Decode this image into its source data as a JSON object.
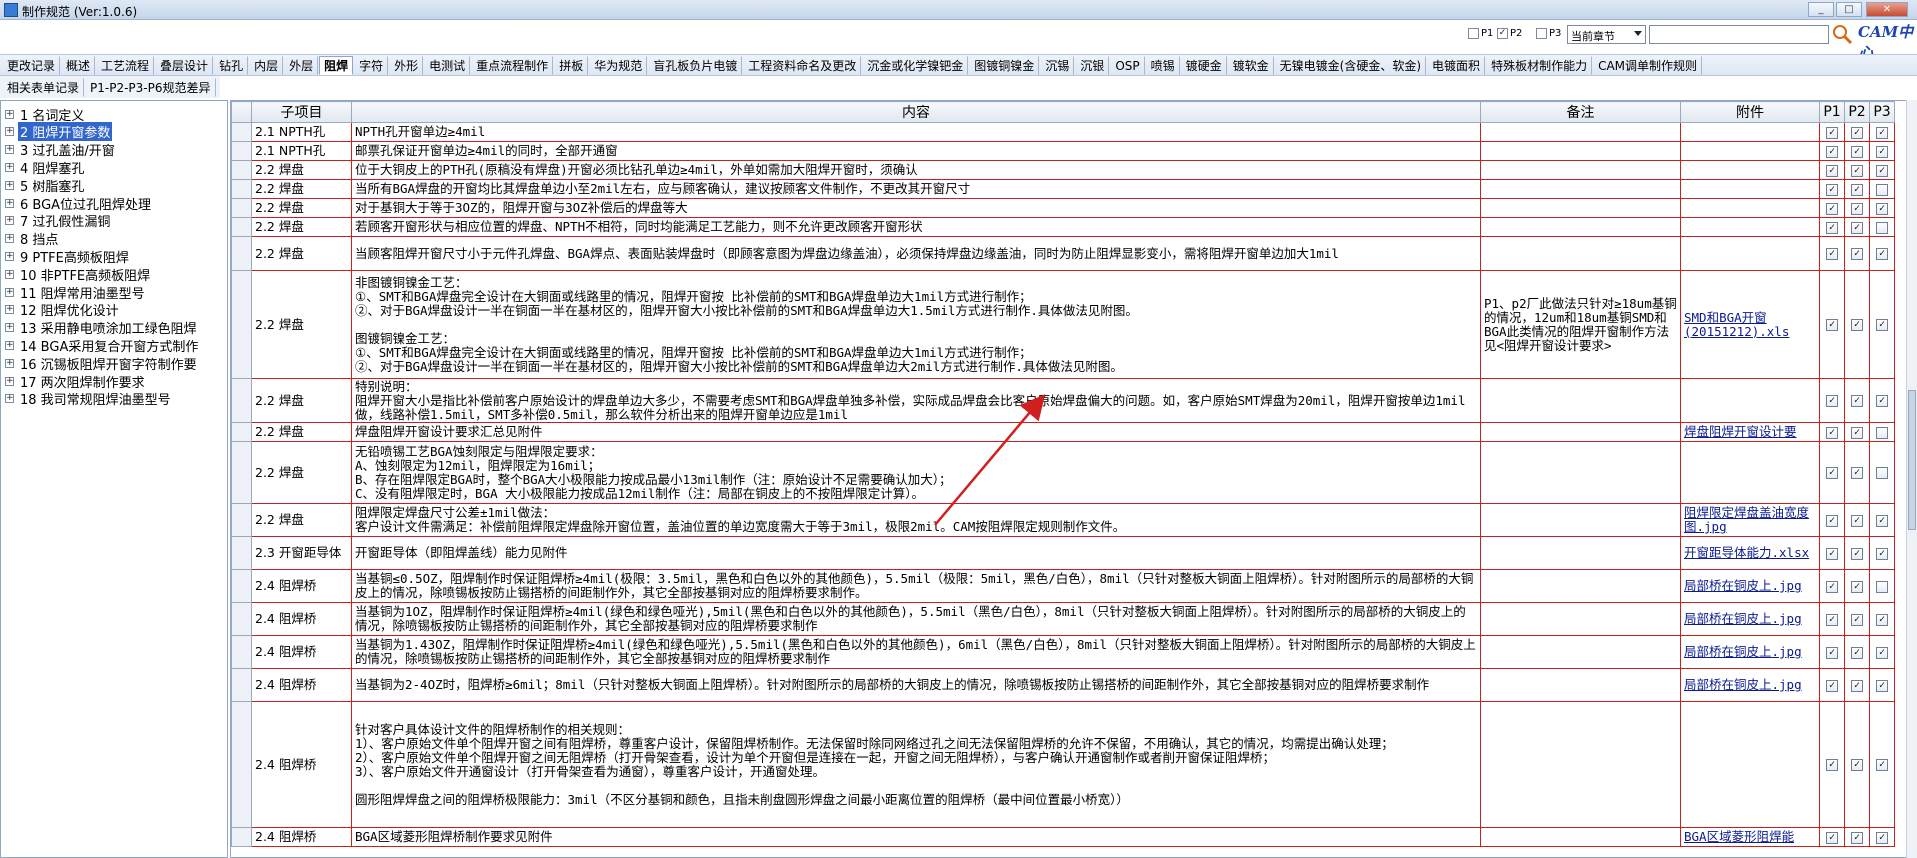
{
  "window": {
    "title": "制作规范 (Ver:1.0.6)"
  },
  "filters": {
    "p1_label": "P1",
    "p1_checked": false,
    "p2_label": "P2",
    "p2_checked": true,
    "p3_label": "P3",
    "p3_checked": false,
    "chapter_select": "当前章节",
    "search_value": "",
    "logo_text": "CAM中心"
  },
  "nav": {
    "row1": [
      "更改记录",
      "概述",
      "工艺流程",
      "叠层设计",
      "钻孔",
      "内层",
      "外层",
      "阻焊",
      "字符",
      "外形",
      "电测试",
      "重点流程制作",
      "拼板",
      "华为规范",
      "盲孔板负片电镀",
      "工程资料命名及更改",
      "沉金或化学镍钯金",
      "图镀铜镍金",
      "沉锡",
      "沉银",
      "OSP",
      "喷锡",
      "镀硬金",
      "镀软金",
      "无镍电镀金(含硬金、软金)",
      "电镀面积",
      "特殊板材制作能力",
      "CAM调单制作规则"
    ],
    "row2": [
      "相关表单记录",
      "P1-P2-P3-P6规范差异"
    ],
    "active": "阻焊"
  },
  "tree": [
    {
      "label": "1  名词定义"
    },
    {
      "label": "2  阻焊开窗参数",
      "selected": true
    },
    {
      "label": "3  过孔盖油/开窗"
    },
    {
      "label": "4  阻焊塞孔"
    },
    {
      "label": "5  树脂塞孔"
    },
    {
      "label": "6  BGA位过孔阻焊处理"
    },
    {
      "label": "7  过孔假性漏铜"
    },
    {
      "label": "8  挡点"
    },
    {
      "label": "9  PTFE高频板阻焊"
    },
    {
      "label": "10  非PTFE高频板阻焊"
    },
    {
      "label": "11  阻焊常用油墨型号"
    },
    {
      "label": "12  阻焊优化设计"
    },
    {
      "label": "13  采用静电喷涂加工绿色阻焊"
    },
    {
      "label": "14  BGA采用复合开窗方式制作"
    },
    {
      "label": "16  沉锡板阻焊开窗字符制作要"
    },
    {
      "label": "17  两次阻焊制作要求"
    },
    {
      "label": "18  我司常规阻焊油墨型号"
    }
  ],
  "grid": {
    "headers": {
      "sub": "子项目",
      "content": "内容",
      "remark": "备注",
      "attach": "附件",
      "p1": "P1",
      "p2": "P2",
      "p3": "P3"
    },
    "rows": [
      {
        "sub": "2.1 NPTH孔",
        "content": "NPTH孔开窗单边≥4mil",
        "remark": "",
        "attach": "",
        "p": [
          true,
          true,
          true
        ]
      },
      {
        "sub": "2.1 NPTH孔",
        "content": "邮票孔保证开窗单边≥4mil的同时，全部开通窗",
        "remark": "",
        "attach": "",
        "p": [
          true,
          true,
          true
        ]
      },
      {
        "sub": "2.2 焊盘",
        "content": "位于大铜皮上的PTH孔(原稿没有焊盘)开窗必须比钻孔单边≥4mil，外单如需加大阻焊开窗时，须确认",
        "remark": "",
        "attach": "",
        "p": [
          true,
          true,
          true
        ]
      },
      {
        "sub": "2.2 焊盘",
        "content": "当所有BGA焊盘的开窗均比其焊盘单边小至2mil左右，应与顾客确认，建议按顾客文件制作，不更改其开窗尺寸",
        "remark": "",
        "attach": "",
        "p": [
          true,
          true,
          false
        ]
      },
      {
        "sub": "2.2 焊盘",
        "content": "对于基铜大于等于3OZ的，阻焊开窗与3OZ补偿后的焊盘等大",
        "remark": "",
        "attach": "",
        "p": [
          true,
          true,
          true
        ]
      },
      {
        "sub": "2.2 焊盘",
        "content": "若顾客开窗形状与相应位置的焊盘、NPTH不相符，同时均能满足工艺能力，则不允许更改顾客开窗形状",
        "remark": "",
        "attach": "",
        "p": [
          true,
          true,
          false
        ]
      },
      {
        "sub": "2.2 焊盘",
        "content": "当顾客阻焊开窗尺寸小于元件孔焊盘、BGA焊点、表面贴装焊盘时（即顾客意图为焊盘边缘盖油），必须保持焊盘边缘盖油，同时为防止阻焊显影变小，需将阻焊开窗单边加大1mil",
        "remark": "",
        "attach": "",
        "p": [
          true,
          true,
          true
        ]
      },
      {
        "sub": "2.2 焊盘",
        "content": "非图镀铜镍金工艺：\n①、SMT和BGA焊盘完全设计在大铜面或线路里的情况，阻焊开窗按 比补偿前的SMT和BGA焊盘单边大1mil方式进行制作；\n②、对于BGA焊盘设计一半在铜面一半在基材区的，阻焊开窗大小按比补偿前的SMT和BGA焊盘单边大1.5mil方式进行制作.具体做法见附图。\n\n图镀铜镍金工艺：\n①、SMT和BGA焊盘完全设计在大铜面或线路里的情况，阻焊开窗按 比补偿前的SMT和BGA焊盘单边大1mil方式进行制作；\n②、对于BGA焊盘设计一半在铜面一半在基材区的，阻焊开窗大小按比补偿前的SMT和BGA焊盘单边大2mil方式进行制作.具体做法见附图。",
        "remark": "P1、p2厂此做法只针对≥18um基铜的情况，12um和18um基铜SMD和BGA此类情况的阻焊开窗制作方法见<阻焊开窗设计要求>",
        "attach": "SMD和BGA开窗 (20151212).xls",
        "p": [
          true,
          true,
          true
        ]
      },
      {
        "sub": "2.2 焊盘",
        "content": "特别说明：\n阻焊开窗大小是指比补偿前客户原始设计的焊盘单边大多少，不需要考虑SMT和BGA焊盘单独多补偿，实际成品焊盘会比客户原始焊盘偏大的问题。如，客户原始SMT焊盘为20mil，阻焊开窗按单边1mil做，线路补偿1.5mil，SMT多补偿0.5mil，那么软件分析出来的阻焊开窗单边应是1mil",
        "remark": "",
        "attach": "",
        "p": [
          true,
          true,
          true
        ]
      },
      {
        "sub": "2.2 焊盘",
        "content": "焊盘阻焊开窗设计要求汇总见附件",
        "remark": "",
        "attach": "焊盘阻焊开窗设计要",
        "p": [
          true,
          true,
          false
        ]
      },
      {
        "sub": "2.2 焊盘",
        "content": "无铅喷锡工艺BGA蚀刻限定与阻焊限定要求：\nA、蚀刻限定为12mil，阻焊限定为16mil；\nB、存在阻焊限定BGA时，整个BGA大小极限能力按成品最小13mil制作（注：原始设计不足需要确认加大）；\nC、没有阻焊限定时，BGA 大小极限能力按成品12mil制作（注：局部在铜皮上的不按阻焊限定计算）。",
        "remark": "",
        "attach": "",
        "p": [
          true,
          true,
          false
        ]
      },
      {
        "sub": "2.2 焊盘",
        "content": "阻焊限定焊盘尺寸公差±1mil做法：\n客户设计文件需满足：补偿前阻焊限定焊盘除开窗位置，盖油位置的单边宽度需大于等于3mil，极限2mil。CAM按阻焊限定规则制作文件。",
        "remark": "",
        "attach": "阻焊限定焊盘盖油宽度图.jpg",
        "p": [
          true,
          true,
          true
        ]
      },
      {
        "sub": "2.3 开窗距导体",
        "content": "开窗距导体（即阻焊盖线）能力见附件",
        "remark": "",
        "attach": "开窗距导体能力.xlsx",
        "p": [
          true,
          true,
          true
        ]
      },
      {
        "sub": "2.4 阻焊桥",
        "content": "当基铜≤0.5OZ，阻焊制作时保证阻焊桥≥4mil(极限：3.5mil，黑色和白色以外的其他颜色)，5.5mil（极限：5mil，黑色/白色），8mil（只针对整板大铜面上阻焊桥）。针对附图所示的局部桥的大铜皮上的情况，除喷锡板按防止锡搭桥的间距制作外，其它全部按基铜对应的阻焊桥要求制作。",
        "remark": "",
        "attach": "局部桥在铜皮上.jpg",
        "p": [
          true,
          true,
          false
        ]
      },
      {
        "sub": "2.4 阻焊桥",
        "content": "当基铜为1OZ，阻焊制作时保证阻焊桥≥4mil(绿色和绿色哑光),5mil(黑色和白色以外的其他颜色)，5.5mil（黑色/白色），8mil（只针对整板大铜面上阻焊桥）。针对附图所示的局部桥的大铜皮上的情况，除喷锡板按防止锡搭桥的间距制作外，其它全部按基铜对应的阻焊桥要求制作",
        "remark": "",
        "attach": "局部桥在铜皮上.jpg",
        "p": [
          true,
          true,
          true
        ]
      },
      {
        "sub": "2.4 阻焊桥",
        "content": "当基铜为1.43OZ，阻焊制作时保证阻焊桥≥4mil(绿色和绿色哑光),5.5mil(黑色和白色以外的其他颜色)，6mil（黑色/白色），8mil（只针对整板大铜面上阻焊桥）。针对附图所示的局部桥的大铜皮上的情况，除喷锡板按防止锡搭桥的间距制作外，其它全部按基铜对应的阻焊桥要求制作",
        "remark": "",
        "attach": "局部桥在铜皮上.jpg",
        "p": [
          true,
          true,
          true
        ]
      },
      {
        "sub": "2.4 阻焊桥",
        "content": "当基铜为2-4OZ时，阻焊桥≥6mil；8mil（只针对整板大铜面上阻焊桥）。针对附图所示的局部桥的大铜皮上的情况，除喷锡板按防止锡搭桥的间距制作外，其它全部按基铜对应的阻焊桥要求制作",
        "remark": "",
        "attach": "局部桥在铜皮上.jpg",
        "p": [
          true,
          true,
          true
        ]
      },
      {
        "sub": "2.4 阻焊桥",
        "content": "针对客户具体设计文件的阻焊桥制作的相关规则：\n1）、客户原始文件单个阻焊开窗之间有阻焊桥，尊重客户设计，保留阻焊桥制作。无法保留时除同网络过孔之间无法保留阻焊桥的允许不保留，不用确认，其它的情况，均需提出确认处理；\n2）、客户原始文件单个阻焊开窗之间无阻焊桥（打开骨架查看，设计为单个开窗但是连接在一起，开窗之间无阻焊桥），与客户确认开通窗制作或者削开窗保证阻焊桥；\n3）、客户原始文件开通窗设计（打开骨架查看为通窗），尊重客户设计，开通窗处理。\n\n圆形阻焊焊盘之间的阻焊桥极限能力：3mil（不区分基铜和颜色，且指未削盘圆形焊盘之间最小距离位置的阻焊桥（最中间位置最小桥宽））",
        "remark": "",
        "attach": "",
        "p": [
          true,
          true,
          true
        ]
      },
      {
        "sub": "2.4 阻焊桥",
        "content": "BGA区域菱形阻焊桥制作要求见附件",
        "remark": "",
        "attach": "BGA区域菱形阻焊能",
        "p": [
          true,
          true,
          true
        ]
      }
    ]
  }
}
